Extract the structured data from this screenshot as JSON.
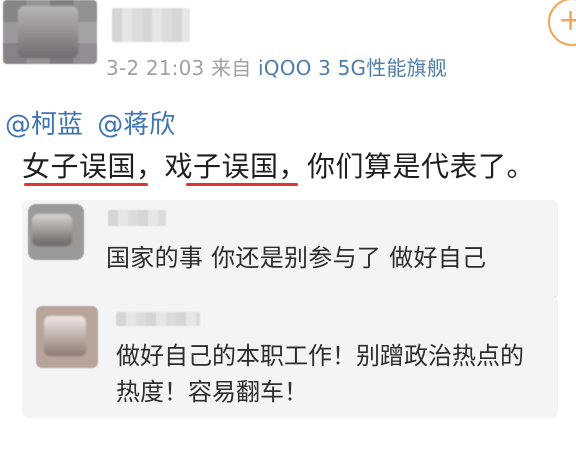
{
  "post": {
    "meta": {
      "time": "3-2 21:03",
      "source_prefix": "来自",
      "device": "iQOO 3 5G性能旗舰"
    },
    "follow_symbol": "+",
    "mentions": [
      "@柯蓝",
      "@蒋欣"
    ],
    "text": "女子误国，戏子误国，你们算是代表了。"
  },
  "replies": [
    {
      "text_lines": [
        "国家的事  你还是别参与了  做好自己"
      ]
    },
    {
      "text_lines": [
        "做好自己的本职工作！别蹭政治热点的",
        "热度！容易翻车！"
      ]
    }
  ],
  "colors": {
    "link_blue": "#3d74b4",
    "device_blue": "#4f7ea8",
    "meta_gray": "#9ea1a6",
    "underline_red": "#e23232",
    "follow_orange": "#f2a65a",
    "reply_bg": "#f3f4f6"
  }
}
